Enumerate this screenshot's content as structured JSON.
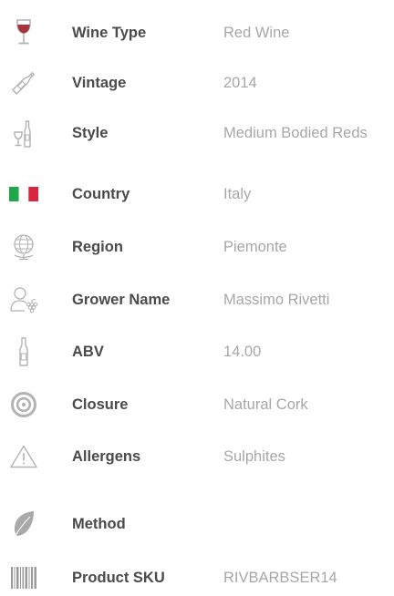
{
  "specs": [
    {
      "icon": "wine-glass-icon",
      "label": "Wine Type",
      "value": "Red Wine"
    },
    {
      "icon": "bottle-icon",
      "label": "Vintage",
      "value": "2014"
    },
    {
      "icon": "bottle-and-glass-icon",
      "label": "Style",
      "value": "Medium Bodied Reds"
    },
    {
      "icon": "italy-flag-icon",
      "label": "Country",
      "value": "Italy"
    },
    {
      "icon": "globe-icon",
      "label": "Region",
      "value": "Piemonte"
    },
    {
      "icon": "grower-icon",
      "label": "Grower Name",
      "value": "Massimo Rivetti"
    },
    {
      "icon": "slim-bottle-icon",
      "label": "ABV",
      "value": "14.00"
    },
    {
      "icon": "cork-icon",
      "label": "Closure",
      "value": "Natural Cork"
    },
    {
      "icon": "warning-icon",
      "label": "Allergens",
      "value": "Sulphites"
    },
    {
      "icon": "leaf-icon",
      "label": "Method",
      "value": ""
    },
    {
      "icon": "barcode-icon",
      "label": "Product SKU",
      "value": "RIVBARBSER14"
    }
  ],
  "colors": {
    "label": "#4a4a4a",
    "value": "#a7a7a7",
    "icon_stroke": "#b3b3b3",
    "wine_red": "#a8333f",
    "flag_green": "#1ea84a",
    "flag_red": "#d7263d"
  }
}
